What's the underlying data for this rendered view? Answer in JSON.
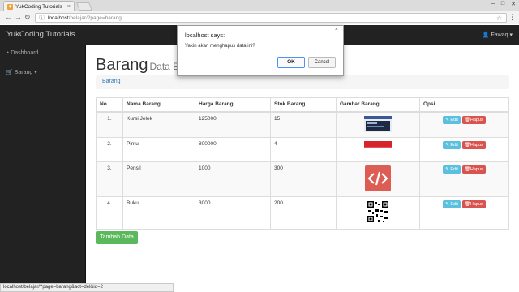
{
  "browser": {
    "tab_title": "YukCoding Tutorials",
    "tab_close": "×",
    "url_host": "localhost",
    "url_path": "/belajar/?page=barang",
    "status_url": "localhost/belajar/?page=barang&act=del&id=2"
  },
  "navbar": {
    "brand": "YukCoding Tutorials",
    "user": "Fawaq"
  },
  "sidebar": {
    "items": [
      {
        "label": "Dashboard",
        "icon": "dashboard-icon"
      },
      {
        "label": "Barang",
        "icon": "cart-icon"
      }
    ]
  },
  "page": {
    "title": "Barang",
    "subtitle": "Data Ba",
    "breadcrumb": "Barang"
  },
  "table": {
    "headers": [
      "No.",
      "Nama Barang",
      "Harga Barang",
      "Stok Barang",
      "Gambar Barang",
      "Opsi"
    ],
    "rows": [
      {
        "no": "1.",
        "nama": "Kursi Jelek",
        "harga": "125000",
        "stok": "15",
        "gambar": "screenshot-thumbnail"
      },
      {
        "no": "2.",
        "nama": "Pintu",
        "harga": "800000",
        "stok": "4",
        "gambar": "red-white-flag-image"
      },
      {
        "no": "3.",
        "nama": "Pensil",
        "harga": "1000",
        "stok": "300",
        "gambar": "code-icon-image"
      },
      {
        "no": "4.",
        "nama": "Buku",
        "harga": "3000",
        "stok": "200",
        "gambar": "qr-code-image"
      }
    ],
    "edit_label": "Edit",
    "delete_label": "Hapus"
  },
  "add_button": "Tambah Data",
  "dialog": {
    "title": "localhost says:",
    "message": "Yakin akan menghapus data ini?",
    "ok": "OK",
    "cancel": "Cancel",
    "close": "×"
  },
  "colors": {
    "navbar": "#222222",
    "edit": "#5bc0de",
    "delete": "#d9534f",
    "add": "#5cb85c",
    "link": "#337ab7"
  }
}
